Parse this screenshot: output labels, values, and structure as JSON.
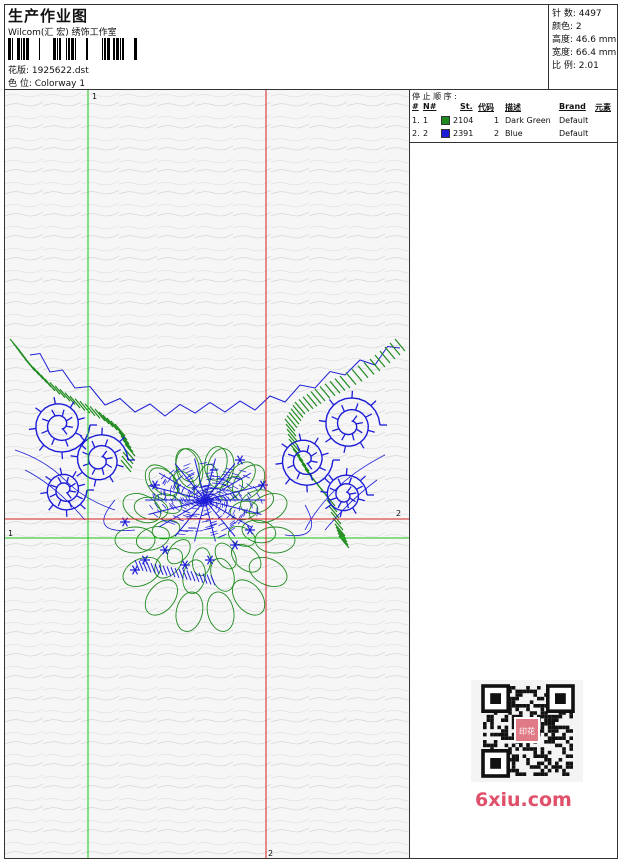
{
  "header": {
    "title": "生产作业图",
    "company": "Wilcom(汇 宏) 绣饰工作室",
    "design_label": "花版: 1925622.dst",
    "colorway_label": "色 位:  Colorway 1"
  },
  "stats": {
    "stitches": "针 数:  4497",
    "colors": "颜色:  2",
    "height": "高度:  46.6 mm",
    "width": "宽度:  66.4 mm",
    "scale": "比 例:  2.01"
  },
  "stop_sequence": {
    "title": "停 止 顺 序 :",
    "headers": {
      "num": "#",
      "n": "N#",
      "st": "St.",
      "code": "代码",
      "desc": "描述",
      "brand": "Brand",
      "element": "元素"
    },
    "rows": [
      {
        "num": "1.",
        "n": "1",
        "st": "2104",
        "code": "1",
        "desc": "Dark Green",
        "brand": "Default",
        "color": "#1e8a1e"
      },
      {
        "num": "2.",
        "n": "2",
        "st": "2391",
        "code": "2",
        "desc": "Blue",
        "brand": "Default",
        "color": "#1c1cd8"
      }
    ]
  },
  "guides": {
    "v1_label": "1",
    "h1_label": "1",
    "v2_label": "2",
    "h2_label": "2"
  },
  "watermark": {
    "text": "6xiu.com",
    "qr_badge": "印花"
  },
  "colors": {
    "green": "#1e8a1e",
    "blue": "#1c1cd8",
    "red": "#d42020",
    "lime": "#18c418"
  }
}
